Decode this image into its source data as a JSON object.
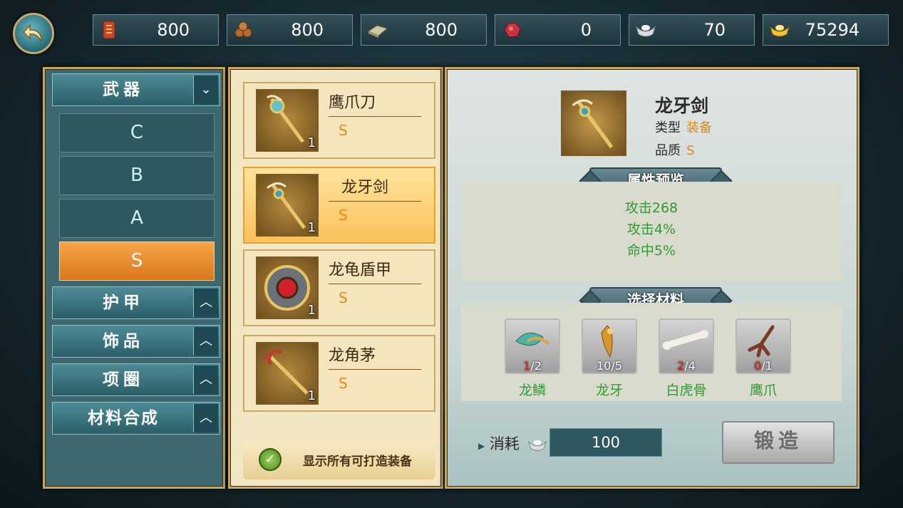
{
  "resources": [
    {
      "icon": "scroll-icon",
      "value": "800"
    },
    {
      "icon": "wood-icon",
      "value": "800"
    },
    {
      "icon": "stone-slab-icon",
      "value": "800"
    },
    {
      "icon": "ore-icon",
      "value": "0"
    },
    {
      "icon": "silver-ingot-icon",
      "value": "70"
    },
    {
      "icon": "gold-ingot-icon",
      "value": "75294"
    }
  ],
  "categories": {
    "weapon": {
      "label": "武器",
      "arrow": "⌄"
    },
    "grades": [
      {
        "label": "C"
      },
      {
        "label": "B"
      },
      {
        "label": "A"
      },
      {
        "label": "S",
        "selected": true
      }
    ],
    "armor": {
      "label": "护甲",
      "arrow": "︿"
    },
    "accessory": {
      "label": "饰品",
      "arrow": "︿"
    },
    "necklace": {
      "label": "项圈",
      "arrow": "︿"
    },
    "material_synth": {
      "label": "材料合成",
      "arrow": "︿"
    }
  },
  "items": [
    {
      "name": "鹰爪刀",
      "quality": "S",
      "count": "1",
      "icon": "staff-icon"
    },
    {
      "name": "龙牙剑",
      "quality": "S",
      "count": "1",
      "icon": "sword-icon",
      "selected": true
    },
    {
      "name": "龙龟盾甲",
      "quality": "S",
      "count": "1",
      "icon": "shield-icon"
    },
    {
      "name": "龙角茅",
      "quality": "S",
      "count": "1",
      "icon": "spear-icon"
    }
  ],
  "show_all": {
    "label": "显示所有可打造装备",
    "checked": true
  },
  "detail": {
    "name": "龙牙剑",
    "type_label": "类型",
    "type_value": "装备",
    "quality_label": "品质",
    "quality_value": "S",
    "attr_title": "属性预览",
    "attrs": [
      "攻击268",
      "攻击4%",
      "命中5%"
    ],
    "mat_title": "选择材料",
    "materials": [
      {
        "name": "龙鳞",
        "have": "1",
        "need": "2",
        "lack": true,
        "icon": "dragon-scale-icon"
      },
      {
        "name": "龙牙",
        "have": "10",
        "need": "5",
        "lack": false,
        "icon": "dragon-tooth-icon"
      },
      {
        "name": "白虎骨",
        "have": "2",
        "need": "4",
        "lack": true,
        "icon": "tiger-bone-icon"
      },
      {
        "name": "鹰爪",
        "have": "0",
        "need": "1",
        "lack": true,
        "icon": "eagle-claw-icon"
      }
    ],
    "cost_label": "消耗",
    "cost_value": "100",
    "forge_label": "锻造"
  }
}
